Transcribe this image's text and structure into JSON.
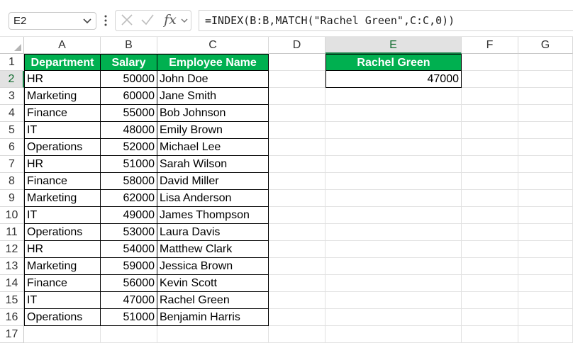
{
  "name_box": {
    "value": "E2"
  },
  "formula_bar": {
    "formula": "=INDEX(B:B,MATCH(\"Rachel Green\",C:C,0))",
    "fx_label": "fx"
  },
  "columns": [
    "A",
    "B",
    "C",
    "D",
    "E",
    "F",
    "G"
  ],
  "selected_column": "E",
  "selected_row": 2,
  "rows": [
    "1",
    "2",
    "3",
    "4",
    "5",
    "6",
    "7",
    "8",
    "9",
    "10",
    "11",
    "12",
    "13",
    "14",
    "15",
    "16",
    "17"
  ],
  "table": {
    "headers": [
      "Department",
      "Salary",
      "Employee Name"
    ],
    "rows": [
      [
        "HR",
        "50000",
        "John Doe"
      ],
      [
        "Marketing",
        "60000",
        "Jane Smith"
      ],
      [
        "Finance",
        "55000",
        "Bob Johnson"
      ],
      [
        "IT",
        "48000",
        "Emily Brown"
      ],
      [
        "Operations",
        "52000",
        "Michael Lee"
      ],
      [
        "HR",
        "51000",
        "Sarah Wilson"
      ],
      [
        "Finance",
        "58000",
        "David Miller"
      ],
      [
        "Marketing",
        "62000",
        "Lisa Anderson"
      ],
      [
        "IT",
        "49000",
        "James Thompson"
      ],
      [
        "Operations",
        "53000",
        "Laura Davis"
      ],
      [
        "HR",
        "54000",
        "Matthew Clark"
      ],
      [
        "Marketing",
        "59000",
        "Jessica Brown"
      ],
      [
        "Finance",
        "56000",
        "Kevin Scott"
      ],
      [
        "IT",
        "47000",
        "Rachel Green"
      ],
      [
        "Operations",
        "51000",
        "Benjamin Harris"
      ]
    ]
  },
  "lookup": {
    "header": "Rachel Green",
    "result": "47000"
  },
  "colors": {
    "header_green": "#00b050",
    "selection_green": "#107c41"
  }
}
